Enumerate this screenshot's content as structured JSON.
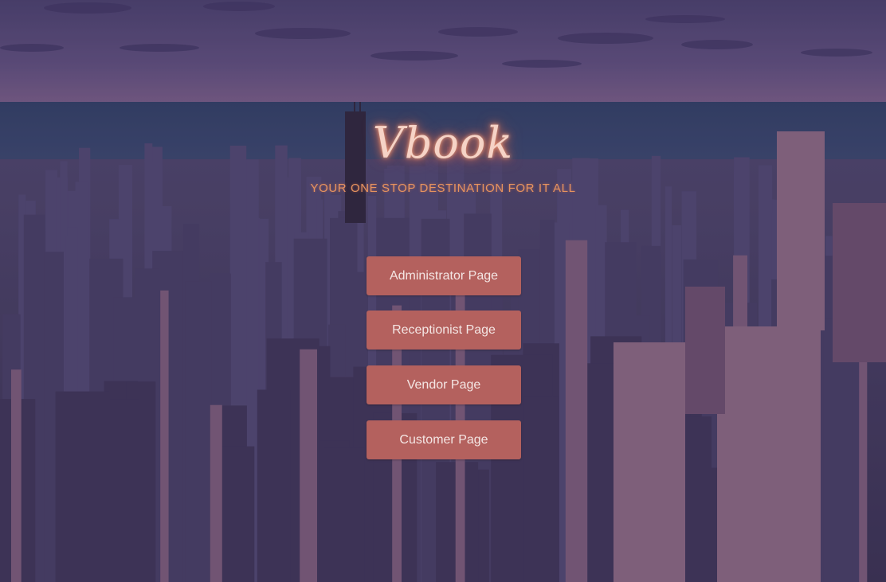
{
  "brand": {
    "logo": "Vbook",
    "tagline": "YOUR ONE STOP DESTINATION FOR IT ALL"
  },
  "buttons": {
    "administrator": "Administrator Page",
    "receptionist": "Receptionist Page",
    "vendor": "Vendor Page",
    "customer": "Customer Page"
  },
  "colors": {
    "button_bg": "#b4615e",
    "logo_glow": "#e0785a",
    "tagline": "#e6935f",
    "sky": "#4e4470",
    "water": "#2f4566",
    "city": "#3e3658"
  }
}
